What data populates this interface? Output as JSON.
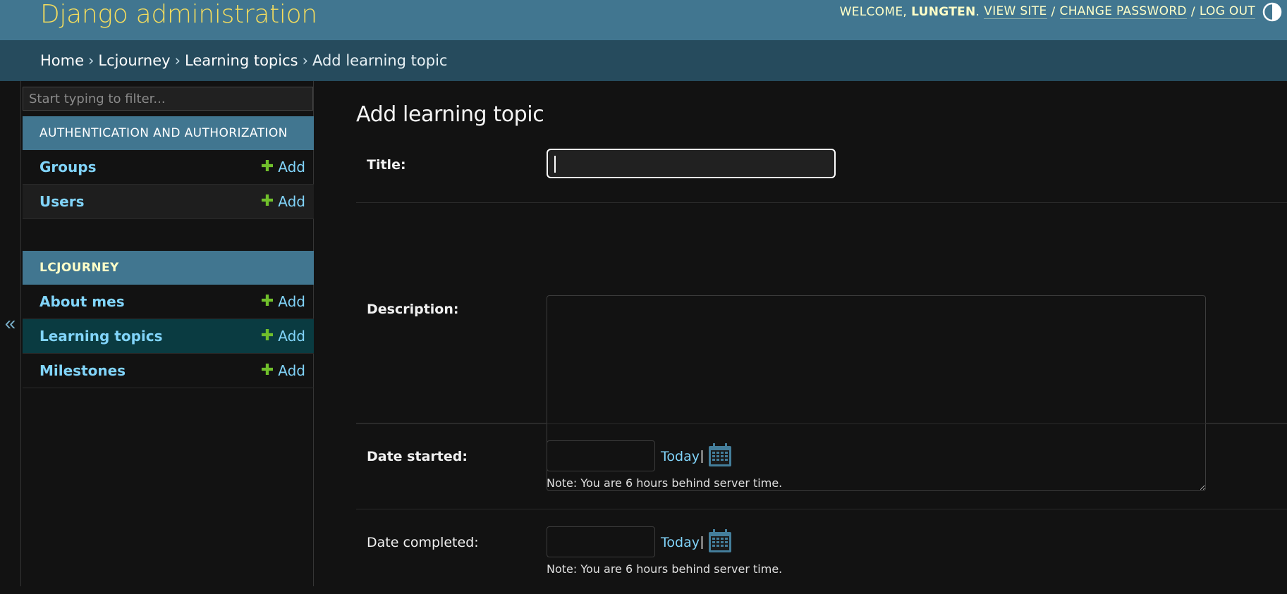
{
  "header": {
    "site_name": "Django administration",
    "welcome": "WELCOME,",
    "username": "LUNGTEN",
    "username_suffix": ".",
    "view_site": "VIEW SITE",
    "change_password": "CHANGE PASSWORD",
    "log_out": "LOG OUT",
    "separator": "/",
    "theme_toggle_icon": "half-circle-icon"
  },
  "breadcrumbs": {
    "items": [
      "Home",
      "Lcjourney",
      "Learning topics"
    ],
    "current": "Add learning topic",
    "arrow": "›"
  },
  "sidebar": {
    "filter_placeholder": "Start typing to filter...",
    "collapse_glyph": "«",
    "modules": [
      {
        "caption": "AUTHENTICATION AND AUTHORIZATION",
        "models": [
          {
            "name": "Groups",
            "add": "Add"
          },
          {
            "name": "Users",
            "add": "Add"
          }
        ]
      },
      {
        "caption": "LCJOURNEY",
        "models": [
          {
            "name": "About mes",
            "add": "Add"
          },
          {
            "name": "Learning topics",
            "add": "Add"
          },
          {
            "name": "Milestones",
            "add": "Add"
          }
        ]
      }
    ],
    "current_model": "Learning topics"
  },
  "form": {
    "title": "Add learning topic",
    "fields": {
      "title": {
        "label": "Title:",
        "value": ""
      },
      "description": {
        "label": "Description:",
        "value": ""
      },
      "date_started": {
        "label": "Date started:",
        "value": "",
        "today": "Today",
        "pipe": "|",
        "note": "Note: You are 6 hours behind server time."
      },
      "date_completed": {
        "label": "Date completed:",
        "value": "",
        "today": "Today",
        "pipe": "|",
        "note": "Note: You are 6 hours behind server time."
      }
    }
  },
  "colors": {
    "header_bg": "#417690",
    "breadcrumbs_bg": "#264b5d",
    "site_name": "#f5dd5d",
    "link": "#81d4fa",
    "add_plus": "#70bf2b",
    "current_row_bg": "#0a3b41",
    "page_bg": "#121212"
  }
}
